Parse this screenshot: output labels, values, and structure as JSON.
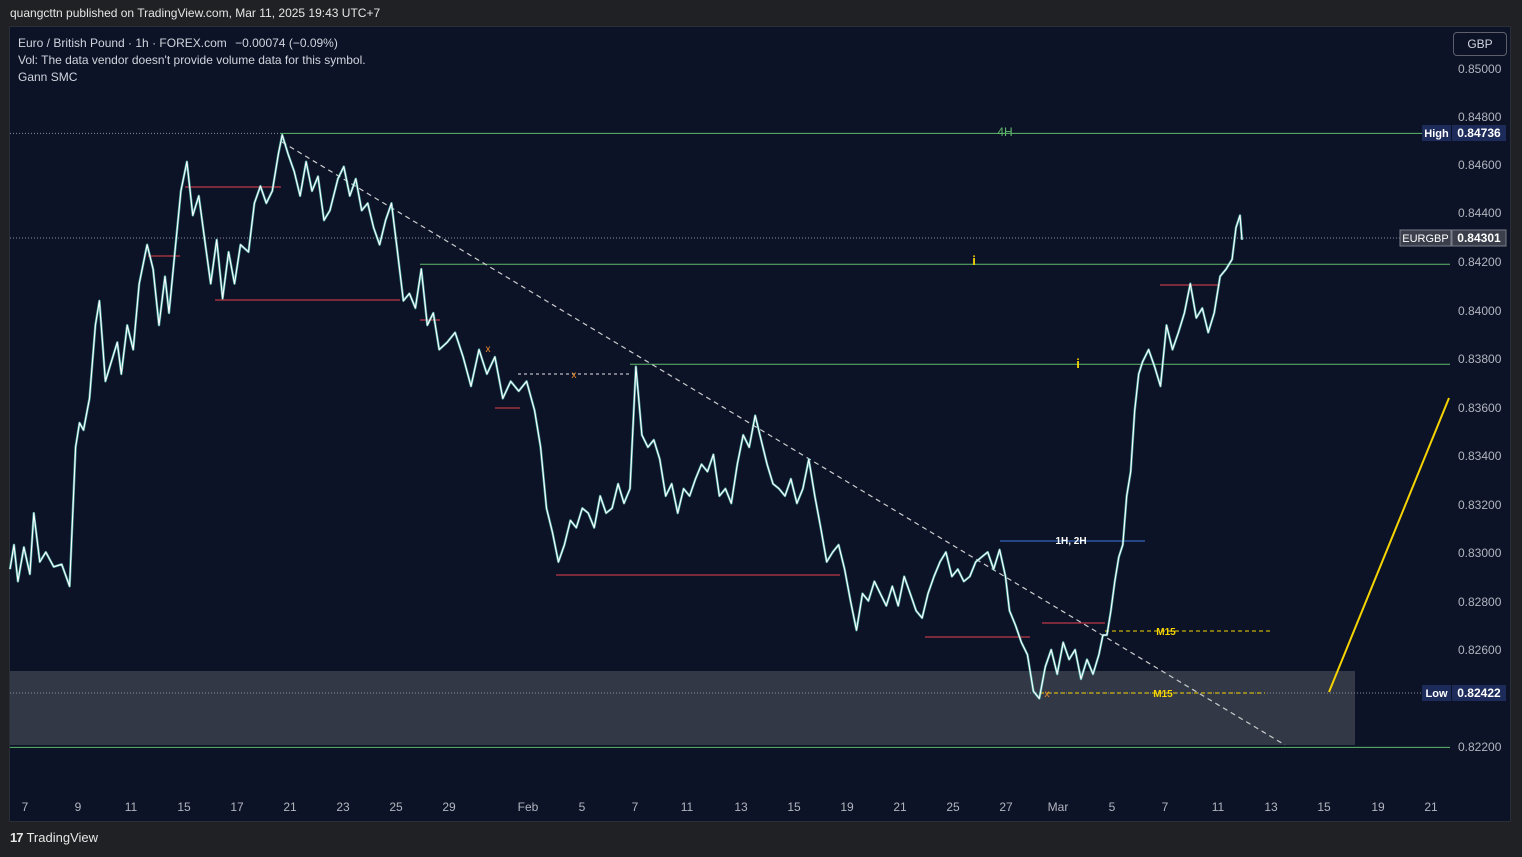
{
  "publisher": "quangcttn published on TradingView.com, Mar 11, 2025 19:43 UTC+7",
  "legend": {
    "symbol_line": "Euro / British Pound · 1h · FOREX.com",
    "change": "−0.00074 (−0.09%)",
    "vol_line": "Vol: The data vendor doesn't provide volume data for this symbol.",
    "indicator": "Gann SMC"
  },
  "currency_button": "GBP",
  "footer": {
    "brand": "TradingView",
    "logo": "17"
  },
  "colors": {
    "background": "#0c1327",
    "candle": "#ffffff",
    "candle_wick": "#5ed3c8",
    "level_green": "#5fb86a",
    "level_red": "#e8424f",
    "level_blue": "#3d7be0",
    "m15_yellow": "#f5d400",
    "zone_gray": "#3a3f4b",
    "projection_yellow": "#f5d400",
    "trendline": "#cccccc"
  },
  "chart_data": {
    "type": "line",
    "series": [
      {
        "values": [
          [
            0,
            0.8295
          ],
          [
            4,
            0.8305
          ],
          [
            8,
            0.829
          ],
          [
            14,
            0.8304
          ],
          [
            20,
            0.8293
          ],
          [
            24,
            0.8318
          ],
          [
            30,
            0.8298
          ],
          [
            36,
            0.8302
          ],
          [
            44,
            0.8296
          ],
          [
            52,
            0.8297
          ],
          [
            60,
            0.8288
          ],
          [
            66,
            0.8345
          ],
          [
            70,
            0.8355
          ],
          [
            74,
            0.8352
          ],
          [
            80,
            0.8365
          ],
          [
            86,
            0.8395
          ],
          [
            90,
            0.8405
          ],
          [
            96,
            0.8372
          ],
          [
            102,
            0.838
          ],
          [
            108,
            0.8388
          ],
          [
            112,
            0.8375
          ],
          [
            118,
            0.8395
          ],
          [
            124,
            0.8385
          ],
          [
            130,
            0.8412
          ],
          [
            138,
            0.8428
          ],
          [
            144,
            0.8418
          ],
          [
            150,
            0.8395
          ],
          [
            156,
            0.8415
          ],
          [
            160,
            0.84
          ],
          [
            166,
            0.8425
          ],
          [
            172,
            0.845
          ],
          [
            178,
            0.8462
          ],
          [
            184,
            0.844
          ],
          [
            190,
            0.8448
          ],
          [
            196,
            0.843
          ],
          [
            202,
            0.8412
          ],
          [
            208,
            0.843
          ],
          [
            214,
            0.8406
          ],
          [
            220,
            0.8425
          ],
          [
            226,
            0.8412
          ],
          [
            232,
            0.8428
          ],
          [
            240,
            0.8425
          ],
          [
            246,
            0.8445
          ],
          [
            252,
            0.8452
          ],
          [
            258,
            0.8445
          ],
          [
            264,
            0.845
          ],
          [
            270,
            0.8465
          ],
          [
            274,
            0.8473
          ],
          [
            280,
            0.8465
          ],
          [
            286,
            0.8458
          ],
          [
            292,
            0.8448
          ],
          [
            298,
            0.8462
          ],
          [
            304,
            0.845
          ],
          [
            310,
            0.8456
          ],
          [
            316,
            0.8438
          ],
          [
            322,
            0.8442
          ],
          [
            330,
            0.8455
          ],
          [
            336,
            0.846
          ],
          [
            342,
            0.8448
          ],
          [
            348,
            0.8455
          ],
          [
            354,
            0.8442
          ],
          [
            360,
            0.8445
          ],
          [
            366,
            0.8435
          ],
          [
            372,
            0.8428
          ],
          [
            378,
            0.8438
          ],
          [
            384,
            0.8445
          ],
          [
            390,
            0.8425
          ],
          [
            396,
            0.8405
          ],
          [
            402,
            0.8408
          ],
          [
            408,
            0.8402
          ],
          [
            414,
            0.8418
          ],
          [
            420,
            0.8395
          ],
          [
            426,
            0.84
          ],
          [
            432,
            0.8385
          ],
          [
            440,
            0.8388
          ],
          [
            448,
            0.8392
          ],
          [
            456,
            0.8382
          ],
          [
            464,
            0.837
          ],
          [
            472,
            0.8385
          ],
          [
            480,
            0.8375
          ],
          [
            488,
            0.8382
          ],
          [
            496,
            0.8365
          ],
          [
            504,
            0.8372
          ],
          [
            512,
            0.8368
          ],
          [
            520,
            0.8372
          ],
          [
            528,
            0.836
          ],
          [
            534,
            0.8345
          ],
          [
            540,
            0.832
          ],
          [
            546,
            0.831
          ],
          [
            552,
            0.8298
          ],
          [
            558,
            0.8305
          ],
          [
            564,
            0.8315
          ],
          [
            570,
            0.8312
          ],
          [
            576,
            0.832
          ],
          [
            582,
            0.8318
          ],
          [
            588,
            0.8312
          ],
          [
            594,
            0.8325
          ],
          [
            600,
            0.8318
          ],
          [
            606,
            0.832
          ],
          [
            612,
            0.833
          ],
          [
            618,
            0.8322
          ],
          [
            624,
            0.8328
          ],
          [
            630,
            0.8378
          ],
          [
            636,
            0.835
          ],
          [
            642,
            0.8345
          ],
          [
            648,
            0.8348
          ],
          [
            654,
            0.834
          ],
          [
            660,
            0.8325
          ],
          [
            666,
            0.833
          ],
          [
            672,
            0.8318
          ],
          [
            678,
            0.8328
          ],
          [
            684,
            0.8325
          ],
          [
            690,
            0.8332
          ],
          [
            696,
            0.8338
          ],
          [
            702,
            0.8335
          ],
          [
            708,
            0.8342
          ],
          [
            714,
            0.8325
          ],
          [
            720,
            0.8328
          ],
          [
            726,
            0.8322
          ],
          [
            732,
            0.8338
          ],
          [
            738,
            0.835
          ],
          [
            744,
            0.8345
          ],
          [
            750,
            0.8358
          ],
          [
            756,
            0.8348
          ],
          [
            762,
            0.8338
          ],
          [
            768,
            0.833
          ],
          [
            774,
            0.8328
          ],
          [
            780,
            0.8325
          ],
          [
            786,
            0.8332
          ],
          [
            792,
            0.8322
          ],
          [
            798,
            0.8328
          ],
          [
            804,
            0.834
          ],
          [
            810,
            0.8325
          ],
          [
            816,
            0.8312
          ],
          [
            822,
            0.8298
          ],
          [
            828,
            0.8302
          ],
          [
            834,
            0.8305
          ],
          [
            840,
            0.8295
          ],
          [
            846,
            0.8282
          ],
          [
            852,
            0.827
          ],
          [
            858,
            0.8285
          ],
          [
            864,
            0.8282
          ],
          [
            870,
            0.829
          ],
          [
            876,
            0.8285
          ],
          [
            882,
            0.828
          ],
          [
            888,
            0.8288
          ],
          [
            894,
            0.828
          ],
          [
            900,
            0.8292
          ],
          [
            906,
            0.8285
          ],
          [
            912,
            0.8278
          ],
          [
            918,
            0.8275
          ],
          [
            924,
            0.8285
          ],
          [
            930,
            0.8292
          ],
          [
            936,
            0.8298
          ],
          [
            942,
            0.8302
          ],
          [
            948,
            0.8292
          ],
          [
            954,
            0.8295
          ],
          [
            960,
            0.829
          ],
          [
            966,
            0.8292
          ],
          [
            972,
            0.8298
          ],
          [
            978,
            0.83
          ],
          [
            984,
            0.8302
          ],
          [
            990,
            0.8295
          ],
          [
            996,
            0.8303
          ],
          [
            1002,
            0.8292
          ],
          [
            1006,
            0.8278
          ],
          [
            1012,
            0.8272
          ],
          [
            1018,
            0.8265
          ],
          [
            1024,
            0.826
          ],
          [
            1030,
            0.8245
          ],
          [
            1036,
            0.8242
          ],
          [
            1042,
            0.8255
          ],
          [
            1048,
            0.8262
          ],
          [
            1054,
            0.8252
          ],
          [
            1060,
            0.8265
          ],
          [
            1066,
            0.8258
          ],
          [
            1072,
            0.8262
          ],
          [
            1078,
            0.825
          ],
          [
            1084,
            0.8258
          ],
          [
            1090,
            0.8252
          ],
          [
            1096,
            0.826
          ],
          [
            1100,
            0.8268
          ],
          [
            1104,
            0.8268
          ],
          [
            1108,
            0.8278
          ],
          [
            1112,
            0.829
          ],
          [
            1116,
            0.83
          ],
          [
            1120,
            0.8305
          ],
          [
            1124,
            0.8325
          ],
          [
            1128,
            0.8335
          ],
          [
            1132,
            0.836
          ],
          [
            1136,
            0.8375
          ],
          [
            1140,
            0.838
          ],
          [
            1146,
            0.8385
          ],
          [
            1152,
            0.8378
          ],
          [
            1158,
            0.837
          ],
          [
            1164,
            0.8395
          ],
          [
            1170,
            0.8385
          ],
          [
            1176,
            0.8392
          ],
          [
            1182,
            0.84
          ],
          [
            1188,
            0.8412
          ],
          [
            1194,
            0.8398
          ],
          [
            1200,
            0.8402
          ],
          [
            1206,
            0.8392
          ],
          [
            1212,
            0.84
          ],
          [
            1218,
            0.8415
          ],
          [
            1224,
            0.8418
          ],
          [
            1230,
            0.8422
          ],
          [
            1234,
            0.8435
          ],
          [
            1238,
            0.844
          ],
          [
            1240,
            0.843
          ]
        ]
      }
    ],
    "x_tick_labels": [
      "7",
      "9",
      "11",
      "15",
      "17",
      "21",
      "23",
      "25",
      "29",
      "Feb",
      "5",
      "7",
      "11",
      "13",
      "15",
      "19",
      "21",
      "25",
      "27",
      "Mar",
      "5",
      "7",
      "11",
      "13",
      "15",
      "19",
      "21"
    ],
    "y_tick_labels": [
      "0.85000",
      "0.84800",
      "0.84600",
      "0.84400",
      "0.84200",
      "0.84000",
      "0.83800",
      "0.83600",
      "0.83400",
      "0.83200",
      "0.83000",
      "0.82800",
      "0.82600",
      "0.82200"
    ],
    "ylim": [
      0.8216,
      0.8507
    ],
    "price_badges": [
      {
        "label": "High",
        "value": "0.84736"
      },
      {
        "label": "EURGBP",
        "value": "0.84301"
      },
      {
        "label": "Low",
        "value": "0.82422"
      }
    ],
    "annotations": {
      "level_4h": "4H",
      "marker_i": "i",
      "label_1h2h": "1H, 2H",
      "label_m15": "M15",
      "marker_x": "x"
    },
    "levels": [
      {
        "name": "high",
        "price": 0.84736,
        "color": "green"
      },
      {
        "name": "i-upper",
        "price": 0.842,
        "color": "green"
      },
      {
        "name": "i-lower",
        "price": 0.8379,
        "color": "green"
      },
      {
        "name": "zone-bottom",
        "price": 0.8222,
        "color": "green"
      }
    ],
    "grid": false,
    "legend": "top-left"
  }
}
